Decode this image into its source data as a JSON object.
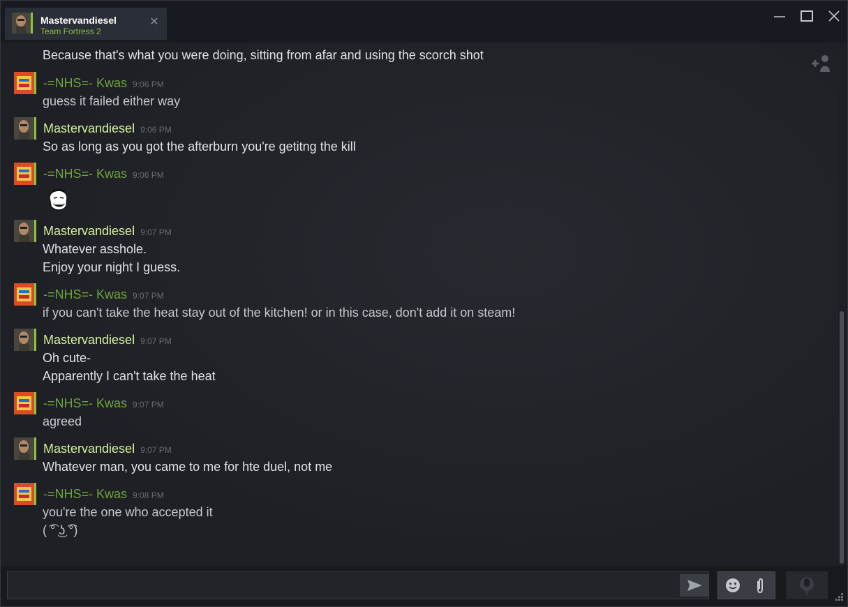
{
  "window": {
    "tab": {
      "name": "Mastervandiesel",
      "game": "Team Fortress 2"
    }
  },
  "chat": {
    "partial_line": "Because that's what you were doing, sitting from afar and using the scorch shot",
    "groups": [
      {
        "author": "-=NHS=- Kwas",
        "time": "9:06 PM",
        "lines": [
          "guess it failed either way"
        ]
      },
      {
        "author": "Mastervandiesel",
        "time": "9:06 PM",
        "lines": [
          "So as long as you got the afterburn you're getitng the kill"
        ]
      },
      {
        "author": "-=NHS=- Kwas",
        "time": "9:06 PM",
        "lines": []
      },
      {
        "author": "Mastervandiesel",
        "time": "9:07 PM",
        "lines": [
          "Whatever asshole.",
          "Enjoy your night I guess."
        ]
      },
      {
        "author": "-=NHS=- Kwas",
        "time": "9:07 PM",
        "lines": [
          "if you can't take the heat stay out of the kitchen! or in this case, don't add it on steam!"
        ]
      },
      {
        "author": "Mastervandiesel",
        "time": "9:07 PM",
        "lines": [
          "Oh cute-",
          "Apparently I can't take the heat"
        ]
      },
      {
        "author": "-=NHS=- Kwas",
        "time": "9:07 PM",
        "lines": [
          "agreed"
        ]
      },
      {
        "author": "Mastervandiesel",
        "time": "9:07 PM",
        "lines": [
          "Whatever man, you came to me for hte duel, not me"
        ]
      },
      {
        "author": "-=NHS=- Kwas",
        "time": "9:08 PM",
        "lines": [
          "you're the one who accepted it",
          "( ͡° ͜ʖ ͡°)"
        ]
      }
    ]
  },
  "input": {
    "placeholder": ""
  },
  "icons": {
    "send": "send-icon",
    "emoji": "emoji-icon",
    "attach": "paperclip-icon",
    "voice": "microphone-icon",
    "add_friend": "add-friend-icon"
  },
  "colors": {
    "self_name": "#d7f29e",
    "other_name": "#6fa33a",
    "status_green": "#8bc53f"
  }
}
